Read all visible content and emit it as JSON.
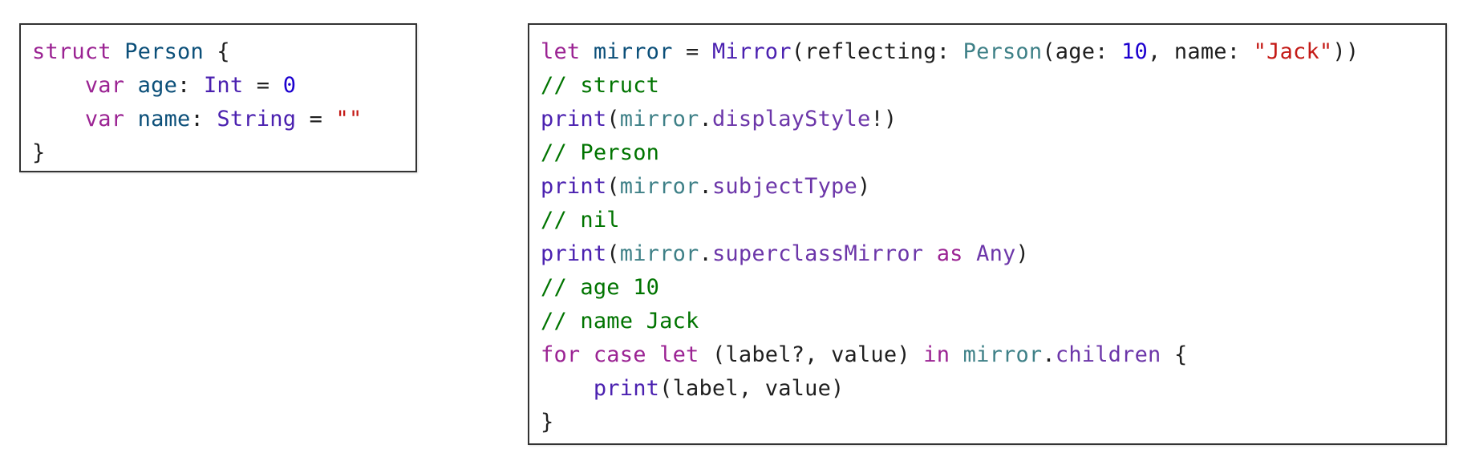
{
  "colors": {
    "keyword": "#9b2393",
    "type": "#0b4f79",
    "library": "#3e8087",
    "number": "#1c00cf",
    "string": "#c41a16",
    "comment": "#007400",
    "plain": "#1f1f1f",
    "border": "#333333"
  },
  "left_code": {
    "lines": [
      [
        {
          "t": "struct",
          "c": "kw"
        },
        {
          "t": " ",
          "c": "plain"
        },
        {
          "t": "Person",
          "c": "type"
        },
        {
          "t": " {",
          "c": "plain"
        }
      ],
      [
        {
          "t": "    ",
          "c": "plain"
        },
        {
          "t": "var",
          "c": "kw"
        },
        {
          "t": " ",
          "c": "plain"
        },
        {
          "t": "age",
          "c": "type"
        },
        {
          "t": ": ",
          "c": "plain"
        },
        {
          "t": "Int",
          "c": "fn"
        },
        {
          "t": " = ",
          "c": "plain"
        },
        {
          "t": "0",
          "c": "num"
        }
      ],
      [
        {
          "t": "    ",
          "c": "plain"
        },
        {
          "t": "var",
          "c": "kw"
        },
        {
          "t": " ",
          "c": "plain"
        },
        {
          "t": "name",
          "c": "type"
        },
        {
          "t": ": ",
          "c": "plain"
        },
        {
          "t": "String",
          "c": "fn"
        },
        {
          "t": " = ",
          "c": "plain"
        },
        {
          "t": "\"\"",
          "c": "str"
        }
      ],
      [
        {
          "t": "}",
          "c": "plain"
        }
      ]
    ]
  },
  "right_code": {
    "lines": [
      [
        {
          "t": "let",
          "c": "kw"
        },
        {
          "t": " ",
          "c": "plain"
        },
        {
          "t": "mirror",
          "c": "type"
        },
        {
          "t": " = ",
          "c": "plain"
        },
        {
          "t": "Mirror",
          "c": "fn"
        },
        {
          "t": "(reflecting: ",
          "c": "plain"
        },
        {
          "t": "Person",
          "c": "lib"
        },
        {
          "t": "(age: ",
          "c": "plain"
        },
        {
          "t": "10",
          "c": "num"
        },
        {
          "t": ", name: ",
          "c": "plain"
        },
        {
          "t": "\"Jack\"",
          "c": "str"
        },
        {
          "t": "))",
          "c": "plain"
        }
      ],
      [
        {
          "t": "// struct",
          "c": "cmt"
        }
      ],
      [
        {
          "t": "print",
          "c": "fn"
        },
        {
          "t": "(",
          "c": "plain"
        },
        {
          "t": "mirror",
          "c": "lib"
        },
        {
          "t": ".",
          "c": "plain"
        },
        {
          "t": "displayStyle",
          "c": "prop"
        },
        {
          "t": "!)",
          "c": "plain"
        }
      ],
      [
        {
          "t": "// Person",
          "c": "cmt"
        }
      ],
      [
        {
          "t": "print",
          "c": "fn"
        },
        {
          "t": "(",
          "c": "plain"
        },
        {
          "t": "mirror",
          "c": "lib"
        },
        {
          "t": ".",
          "c": "plain"
        },
        {
          "t": "subjectType",
          "c": "prop"
        },
        {
          "t": ")",
          "c": "plain"
        }
      ],
      [
        {
          "t": "// nil",
          "c": "cmt"
        }
      ],
      [
        {
          "t": "print",
          "c": "fn"
        },
        {
          "t": "(",
          "c": "plain"
        },
        {
          "t": "mirror",
          "c": "lib"
        },
        {
          "t": ".",
          "c": "plain"
        },
        {
          "t": "superclassMirror",
          "c": "prop"
        },
        {
          "t": " ",
          "c": "plain"
        },
        {
          "t": "as",
          "c": "kw"
        },
        {
          "t": " ",
          "c": "plain"
        },
        {
          "t": "Any",
          "c": "prop"
        },
        {
          "t": ")",
          "c": "plain"
        }
      ],
      [
        {
          "t": "// age 10",
          "c": "cmt"
        }
      ],
      [
        {
          "t": "// name Jack",
          "c": "cmt"
        }
      ],
      [
        {
          "t": "for",
          "c": "kw"
        },
        {
          "t": " ",
          "c": "plain"
        },
        {
          "t": "case",
          "c": "kw"
        },
        {
          "t": " ",
          "c": "plain"
        },
        {
          "t": "let",
          "c": "kw"
        },
        {
          "t": " (label?, value) ",
          "c": "plain"
        },
        {
          "t": "in",
          "c": "kw"
        },
        {
          "t": " ",
          "c": "plain"
        },
        {
          "t": "mirror",
          "c": "lib"
        },
        {
          "t": ".",
          "c": "plain"
        },
        {
          "t": "children",
          "c": "prop"
        },
        {
          "t": " {",
          "c": "plain"
        }
      ],
      [
        {
          "t": "    ",
          "c": "plain"
        },
        {
          "t": "print",
          "c": "fn"
        },
        {
          "t": "(label, value)",
          "c": "plain"
        }
      ],
      [
        {
          "t": "}",
          "c": "plain"
        }
      ]
    ]
  }
}
